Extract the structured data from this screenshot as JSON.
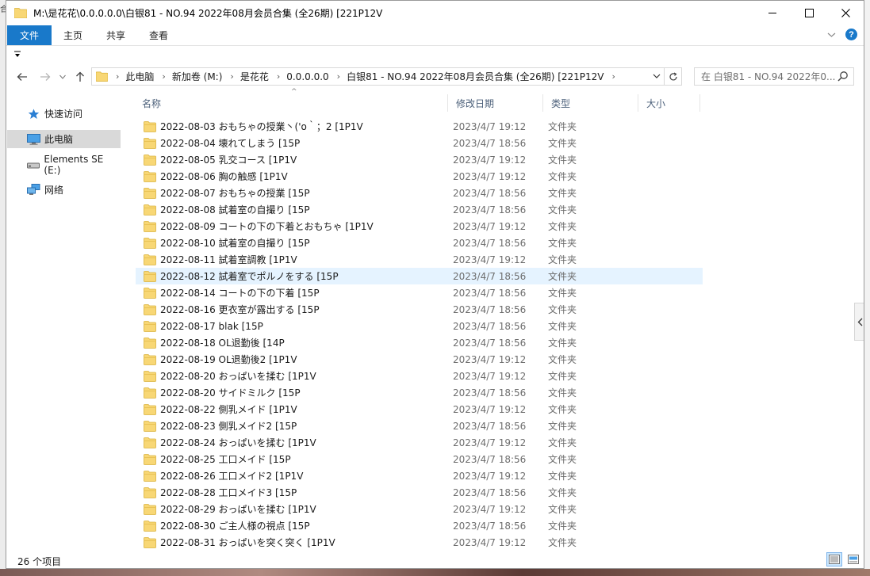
{
  "window": {
    "title": "M:\\是花花\\0.0.0.0.0\\白银81 - NO.94 2022年08月会员合集 (全26期) [221P12V"
  },
  "ribbon": {
    "tabs": [
      "文件",
      "主页",
      "共享",
      "查看"
    ]
  },
  "address": {
    "breadcrumbs": [
      "此电脑",
      "新加卷 (M:)",
      "是花花",
      "0.0.0.0.0",
      "白银81 - NO.94 2022年08月会员合集 (全26期) [221P12V"
    ]
  },
  "search": {
    "placeholder": "在 白银81 - NO.94 2022年0..."
  },
  "sidebar": {
    "items": [
      {
        "label": "快速访问",
        "icon": "star-icon"
      },
      {
        "label": "此电脑",
        "icon": "computer-icon",
        "selected": true
      },
      {
        "label": "Elements SE (E:)",
        "icon": "drive-icon"
      },
      {
        "label": "网络",
        "icon": "network-icon"
      }
    ]
  },
  "columns": {
    "name": "名称",
    "date": "修改日期",
    "type": "类型",
    "size": "大小"
  },
  "files": [
    {
      "name": "2022-08-03 おもちゃの授業丶('o｀；2 [1P1V",
      "date": "2023/4/7 19:12",
      "type": "文件夹"
    },
    {
      "name": "2022-08-04 壊れてしまう [15P",
      "date": "2023/4/7 18:56",
      "type": "文件夹"
    },
    {
      "name": "2022-08-05 乳交コース [1P1V",
      "date": "2023/4/7 19:12",
      "type": "文件夹"
    },
    {
      "name": "2022-08-06 胸の触感 [1P1V",
      "date": "2023/4/7 19:12",
      "type": "文件夹"
    },
    {
      "name": "2022-08-07 おもちゃの授業 [15P",
      "date": "2023/4/7 18:56",
      "type": "文件夹"
    },
    {
      "name": "2022-08-08 試着室の自撮り [15P",
      "date": "2023/4/7 18:56",
      "type": "文件夹"
    },
    {
      "name": "2022-08-09 コートの下の下着とおもちゃ [1P1V",
      "date": "2023/4/7 19:12",
      "type": "文件夹"
    },
    {
      "name": "2022-08-10 試着室の自撮り [15P",
      "date": "2023/4/7 18:56",
      "type": "文件夹"
    },
    {
      "name": "2022-08-11 試着室調教 [1P1V",
      "date": "2023/4/7 19:12",
      "type": "文件夹"
    },
    {
      "name": "2022-08-12 試着室でポルノをする [15P",
      "date": "2023/4/7 18:56",
      "type": "文件夹",
      "hover": true
    },
    {
      "name": "2022-08-14 コートの下の下着 [15P",
      "date": "2023/4/7 18:56",
      "type": "文件夹"
    },
    {
      "name": "2022-08-16 更衣室が露出する [15P",
      "date": "2023/4/7 18:56",
      "type": "文件夹"
    },
    {
      "name": "2022-08-17 blak [15P",
      "date": "2023/4/7 18:56",
      "type": "文件夹"
    },
    {
      "name": "2022-08-18 OL退勤後 [14P",
      "date": "2023/4/7 18:56",
      "type": "文件夹"
    },
    {
      "name": "2022-08-19 OL退勤後2 [1P1V",
      "date": "2023/4/7 19:12",
      "type": "文件夹"
    },
    {
      "name": "2022-08-20 おっぱいを揉む [1P1V",
      "date": "2023/4/7 19:12",
      "type": "文件夹"
    },
    {
      "name": "2022-08-20 サイドミルク [15P",
      "date": "2023/4/7 18:56",
      "type": "文件夹"
    },
    {
      "name": "2022-08-22 側乳メイド [1P1V",
      "date": "2023/4/7 19:12",
      "type": "文件夹"
    },
    {
      "name": "2022-08-23 側乳メイド2 [15P",
      "date": "2023/4/7 18:56",
      "type": "文件夹"
    },
    {
      "name": "2022-08-24 おっぱいを揉む [1P1V",
      "date": "2023/4/7 19:12",
      "type": "文件夹"
    },
    {
      "name": "2022-08-25 工口メイド [15P",
      "date": "2023/4/7 18:56",
      "type": "文件夹"
    },
    {
      "name": "2022-08-26 工口メイド2 [1P1V",
      "date": "2023/4/7 19:12",
      "type": "文件夹"
    },
    {
      "name": "2022-08-28 工口メイド3 [15P",
      "date": "2023/4/7 18:56",
      "type": "文件夹"
    },
    {
      "name": "2022-08-29 おっぱいを揉む [1P1V",
      "date": "2023/4/7 19:12",
      "type": "文件夹"
    },
    {
      "name": "2022-08-30 ご主人様の視点 [15P",
      "date": "2023/4/7 18:56",
      "type": "文件夹"
    },
    {
      "name": "2022-08-31 おっぱいを突く突く [1P1V",
      "date": "2023/4/7 19:12",
      "type": "文件夹"
    }
  ],
  "status": {
    "count": "26 个项目"
  },
  "colors": {
    "accent": "#1979ca",
    "folder": "#f8d775",
    "hover": "#e5f3ff",
    "selected": "#d9d9d9"
  }
}
